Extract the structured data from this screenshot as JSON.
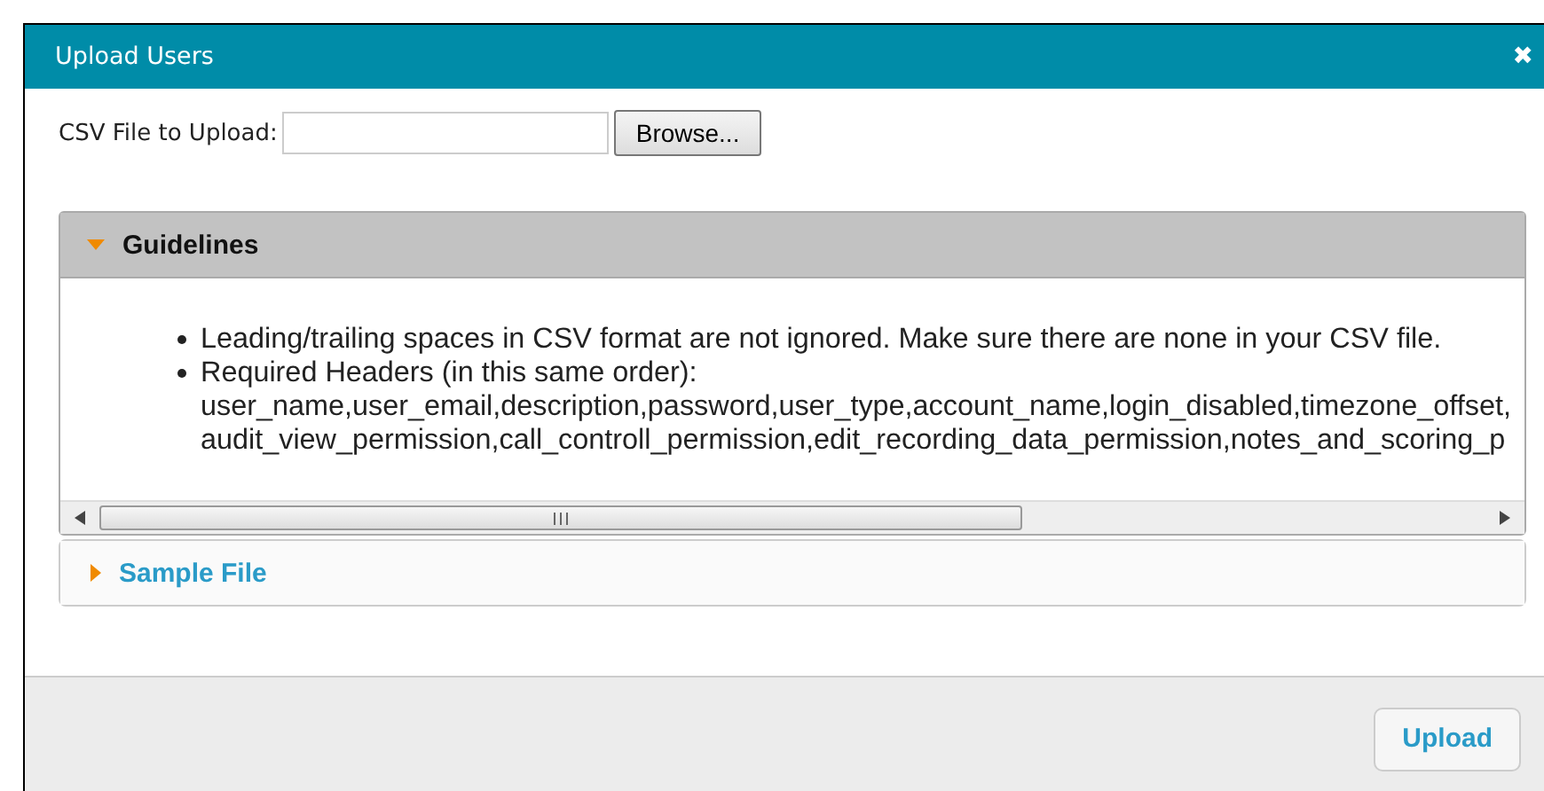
{
  "dialog": {
    "title": "Upload Users",
    "close_icon": "✖"
  },
  "file_field": {
    "label": "CSV File to Upload:",
    "browse_button": "Browse..."
  },
  "sections": [
    {
      "title": "Guidelines",
      "expanded": true,
      "bullets": [
        {
          "text": "Leading/trailing spaces in CSV format are not ignored. Make sure there are none in your CSV file."
        },
        {
          "text": "Required Headers (in this same order):",
          "lines": [
            "user_name,user_email,description,password,user_type,account_name,login_disabled,timezone_offset,",
            "audit_view_permission,call_controll_permission,edit_recording_data_permission,notes_and_scoring_p"
          ]
        }
      ]
    },
    {
      "title": "Sample File",
      "expanded": false
    }
  ],
  "footer": {
    "upload_button": "Upload"
  }
}
